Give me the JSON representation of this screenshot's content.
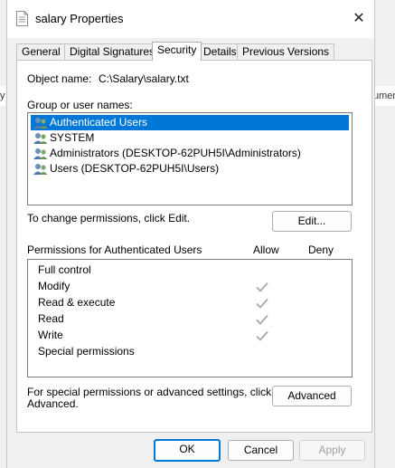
{
  "window": {
    "title": "salary Properties",
    "close_glyph": "✕"
  },
  "tabs": [
    {
      "label": "General",
      "active": false
    },
    {
      "label": "Digital Signatures",
      "active": false
    },
    {
      "label": "Security",
      "active": true
    },
    {
      "label": "Details",
      "active": false
    },
    {
      "label": "Previous Versions",
      "active": false
    }
  ],
  "background": {
    "left_text": "y",
    "right_text": "umen"
  },
  "object": {
    "label": "Object name:",
    "value": "C:\\Salary\\salary.txt"
  },
  "groups": {
    "label": "Group or user names:",
    "items": [
      {
        "name": "Authenticated Users",
        "icon": "group-users-icon",
        "selected": true
      },
      {
        "name": "SYSTEM",
        "icon": "group-users-icon",
        "selected": false
      },
      {
        "name": "Administrators (DESKTOP-62PUH5I\\Administrators)",
        "icon": "group-users-icon",
        "selected": false
      },
      {
        "name": "Users (DESKTOP-62PUH5I\\Users)",
        "icon": "group-users-icon",
        "selected": false
      }
    ]
  },
  "change_text": "To change permissions, click Edit.",
  "edit_button": "Edit...",
  "permissions": {
    "title": "Permissions for Authenticated Users",
    "allow_header": "Allow",
    "deny_header": "Deny",
    "rows": [
      {
        "name": "Full control",
        "allow": false,
        "deny": false
      },
      {
        "name": "Modify",
        "allow": true,
        "deny": false
      },
      {
        "name": "Read & execute",
        "allow": true,
        "deny": false
      },
      {
        "name": "Read",
        "allow": true,
        "deny": false
      },
      {
        "name": "Write",
        "allow": true,
        "deny": false
      },
      {
        "name": "Special permissions",
        "allow": false,
        "deny": false
      }
    ]
  },
  "advanced": {
    "text_line1": "For special permissions or advanced settings, click",
    "text_line2": "Advanced.",
    "button": "Advanced"
  },
  "footer": {
    "ok": "OK",
    "cancel": "Cancel",
    "apply": "Apply"
  },
  "colors": {
    "selection": "#0078d7",
    "check": "#a8a8a8"
  }
}
